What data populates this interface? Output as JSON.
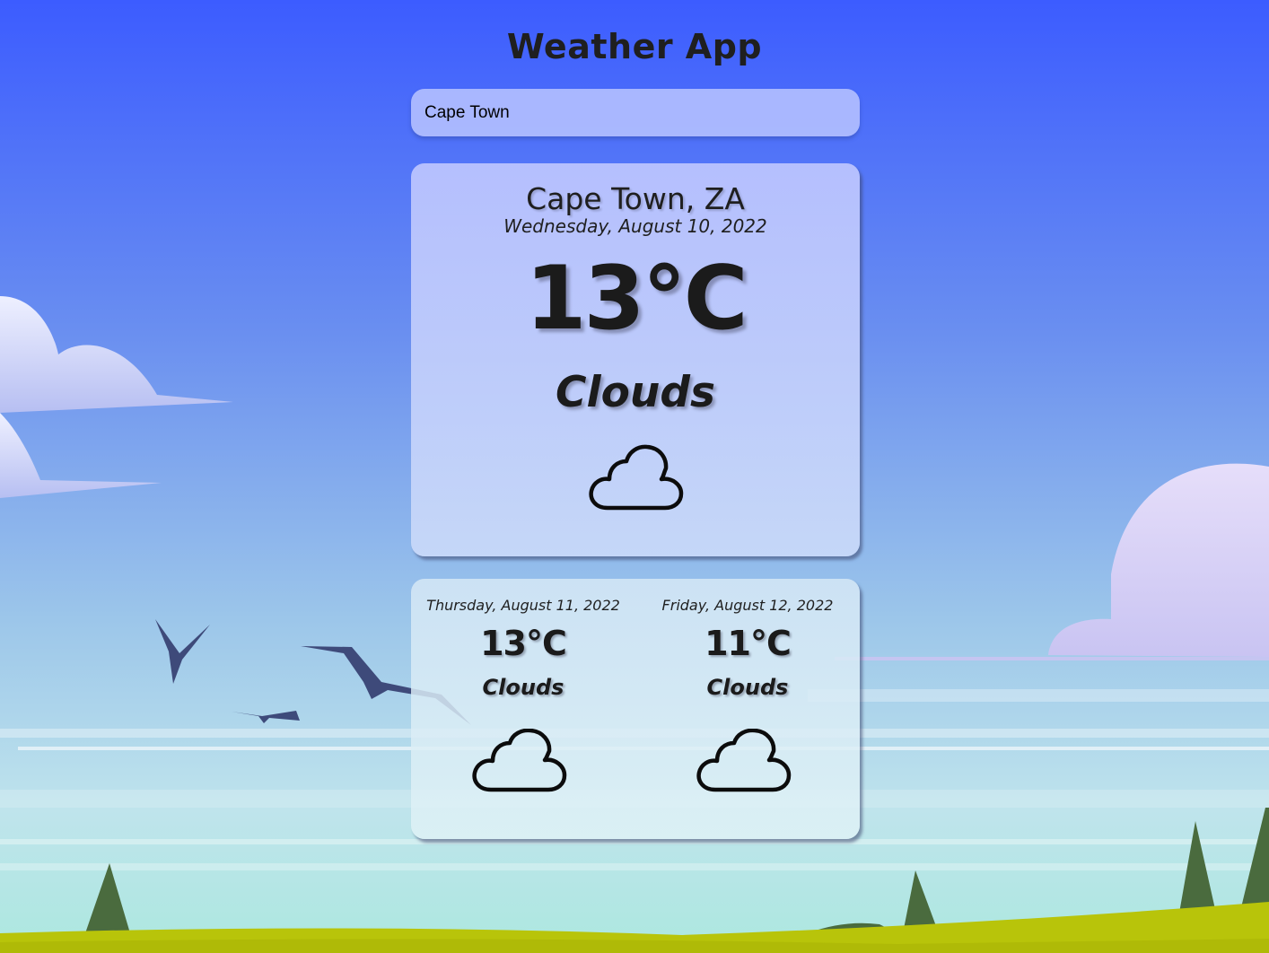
{
  "app": {
    "title": "Weather App"
  },
  "search": {
    "value": "Cape Town"
  },
  "current": {
    "location": "Cape Town, ZA",
    "date": "Wednesday, August 10, 2022",
    "temperature": "13°C",
    "condition": "Clouds",
    "icon": "cloud-icon"
  },
  "forecast": [
    {
      "date": "Thursday, August 11, 2022",
      "temperature": "13°C",
      "condition": "Clouds",
      "icon": "cloud-icon"
    },
    {
      "date": "Friday, August 12, 2022",
      "temperature": "11°C",
      "condition": "Clouds",
      "icon": "cloud-icon"
    }
  ],
  "colors": {
    "sky_top": "#3c5cff",
    "sky_bottom": "#b4e8e6",
    "grass": "#b8c40a",
    "trees": "#4a6b3e",
    "birds": "#3e4a7a"
  }
}
